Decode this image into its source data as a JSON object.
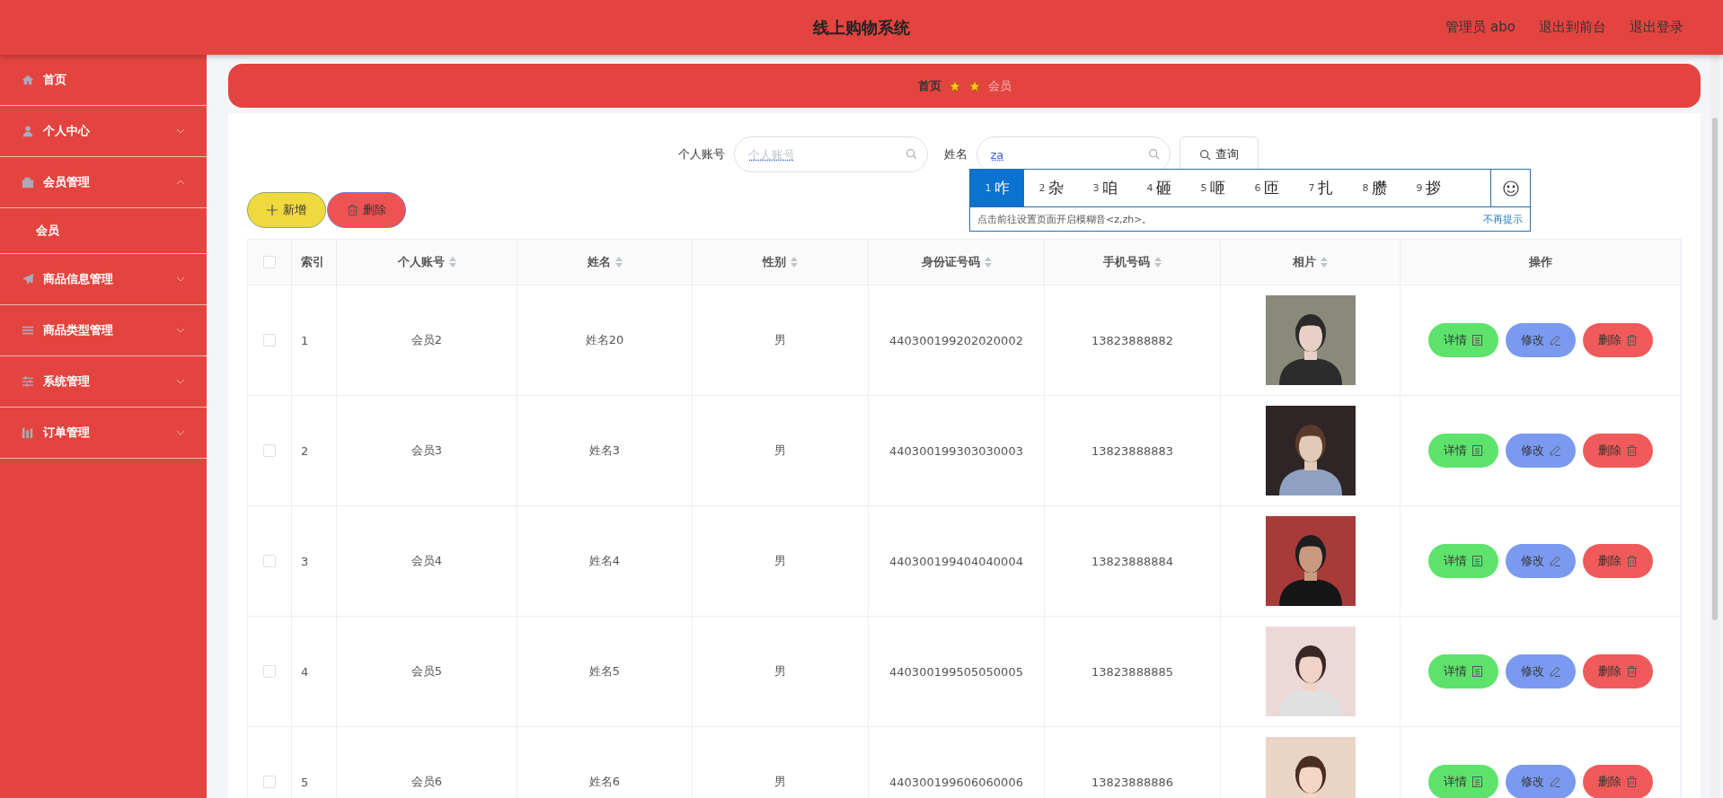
{
  "header": {
    "title": "线上购物系统",
    "links": [
      "管理员 abo",
      "退出到前台",
      "退出登录"
    ]
  },
  "sidebar": {
    "items": [
      {
        "label": "首页"
      },
      {
        "label": "个人中心",
        "expanded": false
      },
      {
        "label": "会员管理",
        "expanded": true,
        "children": [
          {
            "label": "会员"
          }
        ]
      },
      {
        "label": "商品信息管理",
        "expanded": false
      },
      {
        "label": "商品类型管理",
        "expanded": false
      },
      {
        "label": "系统管理",
        "expanded": false
      },
      {
        "label": "订单管理",
        "expanded": false
      }
    ]
  },
  "breadcrumb": {
    "items": [
      {
        "label": "首页",
        "selected": false
      },
      {
        "label": "会员",
        "selected": true
      }
    ]
  },
  "search": {
    "fields": [
      {
        "label": "个人账号",
        "placeholder": "个人账号"
      },
      {
        "label": "姓名",
        "value": "za"
      }
    ],
    "button": "查询"
  },
  "ime": {
    "candidates": [
      {
        "number": "1",
        "text": "咋",
        "selected": true
      },
      {
        "number": "2",
        "text": "杂",
        "selected": false
      },
      {
        "number": "3",
        "text": "咱",
        "selected": false
      },
      {
        "number": "4",
        "text": "砸",
        "selected": false
      },
      {
        "number": "5",
        "text": "咂",
        "selected": false
      },
      {
        "number": "6",
        "text": "匝",
        "selected": false
      },
      {
        "number": "7",
        "text": "扎",
        "selected": false
      },
      {
        "number": "8",
        "text": "臜",
        "selected": false
      },
      {
        "number": "9",
        "text": "拶",
        "selected": false
      }
    ],
    "hint": "点击前往设置页面开启模糊音<z,zh>。",
    "dismiss": "不再提示"
  },
  "actions": [
    {
      "label": "新增",
      "kind": "add"
    },
    {
      "label": "删除",
      "kind": "delete"
    }
  ],
  "table": {
    "header_checked": false,
    "columns": [
      {
        "label": "索引",
        "sortable": false
      },
      {
        "label": "个人账号",
        "sortable": true
      },
      {
        "label": "姓名",
        "sortable": true
      },
      {
        "label": "性别",
        "sortable": true
      },
      {
        "label": "身份证号码",
        "sortable": true
      },
      {
        "label": "手机号码",
        "sortable": true
      },
      {
        "label": "相片",
        "sortable": true
      },
      {
        "label": "操作",
        "sortable": false
      }
    ],
    "rows": [
      {
        "checked": false,
        "cells": [
          "1",
          "会员2",
          "姓名20",
          "男",
          "440300199202020002",
          "13823888882"
        ],
        "photo": {
          "kind": "picture"
        },
        "buttons": [
          {
            "label": "详情",
            "kind": "detail"
          },
          {
            "label": "修改",
            "kind": "edit"
          },
          {
            "label": "删除",
            "kind": "delete"
          }
        ]
      },
      {
        "checked": false,
        "cells": [
          "2",
          "会员3",
          "姓名3",
          "男",
          "440300199303030003",
          "13823888883"
        ],
        "photo": {
          "kind": "picture"
        },
        "buttons": [
          {
            "label": "详情",
            "kind": "detail"
          },
          {
            "label": "修改",
            "kind": "edit"
          },
          {
            "label": "删除",
            "kind": "delete"
          }
        ]
      },
      {
        "checked": false,
        "cells": [
          "3",
          "会员4",
          "姓名4",
          "男",
          "440300199404040004",
          "13823888884"
        ],
        "photo": {
          "kind": "picture"
        },
        "buttons": [
          {
            "label": "详情",
            "kind": "detail"
          },
          {
            "label": "修改",
            "kind": "edit"
          },
          {
            "label": "删除",
            "kind": "delete"
          }
        ]
      },
      {
        "checked": false,
        "cells": [
          "4",
          "会员5",
          "姓名5",
          "男",
          "440300199505050005",
          "13823888885"
        ],
        "photo": {
          "kind": "picture"
        },
        "buttons": [
          {
            "label": "详情",
            "kind": "detail"
          },
          {
            "label": "修改",
            "kind": "edit"
          },
          {
            "label": "删除",
            "kind": "delete"
          }
        ]
      },
      {
        "checked": false,
        "cells": [
          "5",
          "会员6",
          "姓名6",
          "男",
          "440300199606060006",
          "13823888886"
        ],
        "photo": {
          "kind": "picture"
        },
        "buttons": [
          {
            "label": "详情",
            "kind": "detail"
          },
          {
            "label": "修改",
            "kind": "edit"
          },
          {
            "label": "删除",
            "kind": "delete"
          }
        ]
      }
    ]
  }
}
